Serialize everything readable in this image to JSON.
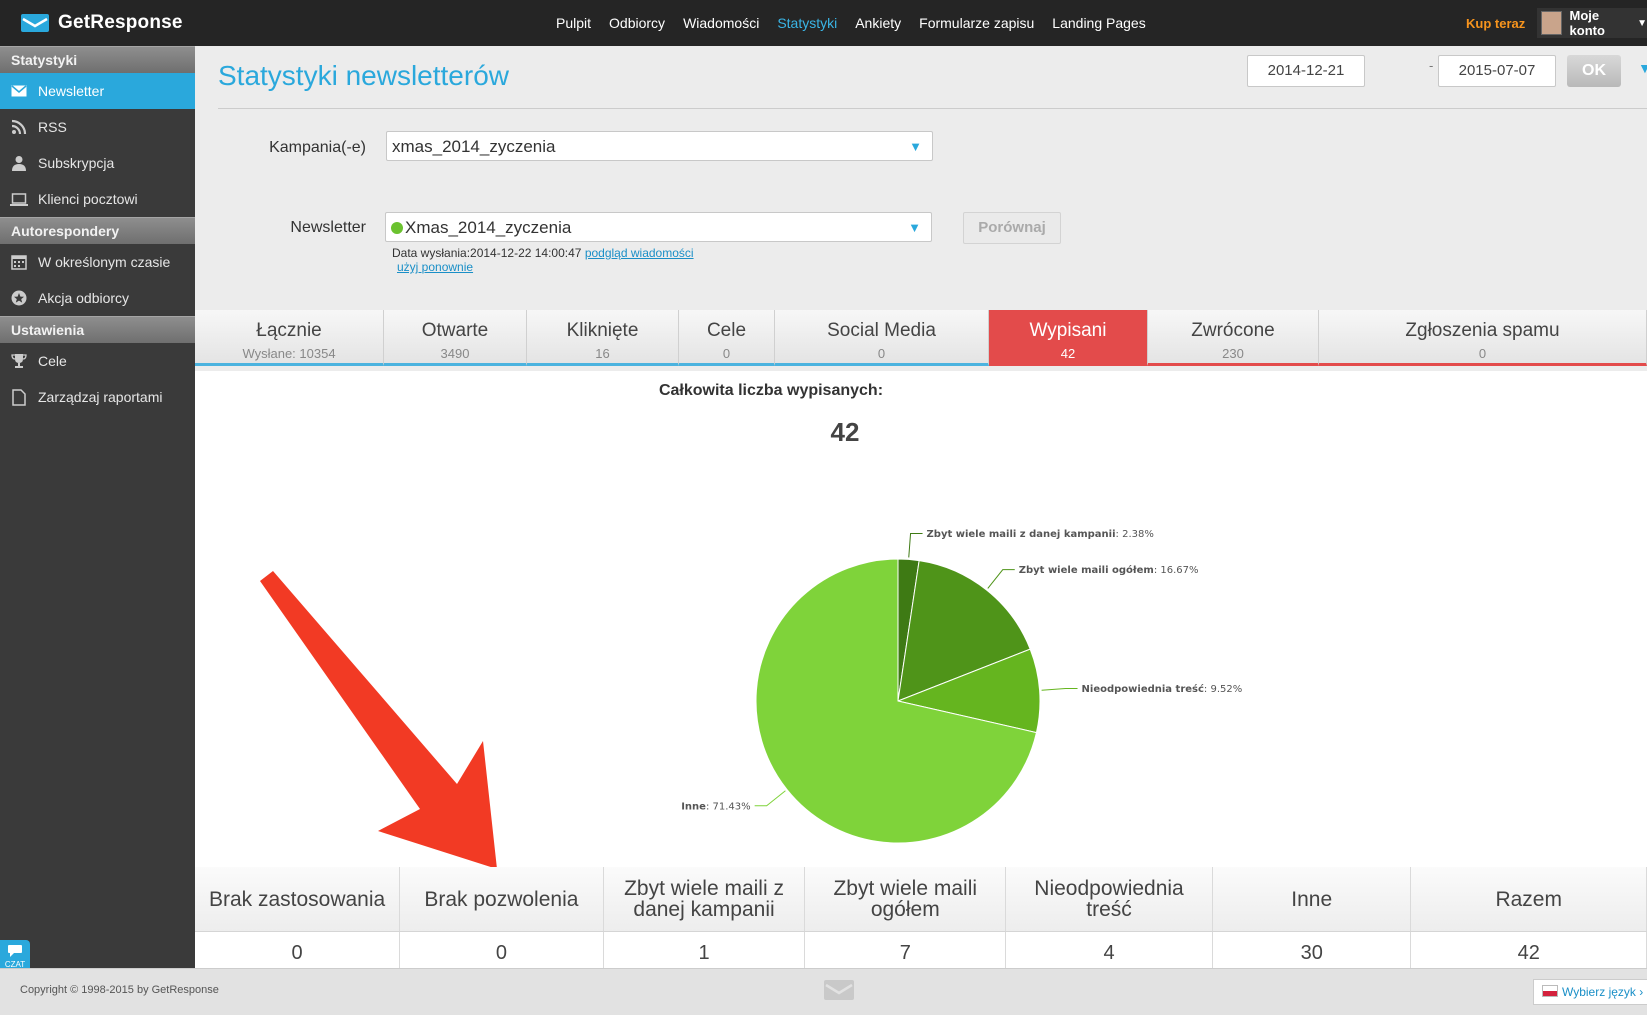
{
  "brand": {
    "name": "GetResponse"
  },
  "topnav": {
    "items": [
      "Pulpit",
      "Odbiorcy",
      "Wiadomości",
      "Statystyki",
      "Ankiety",
      "Formularze zapisu",
      "Landing Pages"
    ],
    "active": "Statystyki",
    "buy_label": "Kup teraz",
    "account_label": "Moje konto"
  },
  "sidebar": {
    "sections": [
      {
        "title": "Statystyki",
        "items": [
          {
            "label": "Newsletter",
            "icon": "envelope-icon",
            "active": true
          },
          {
            "label": "RSS",
            "icon": "rss-icon"
          },
          {
            "label": "Subskrypcja",
            "icon": "user-icon"
          },
          {
            "label": "Klienci pocztowi",
            "icon": "laptop-icon"
          }
        ]
      },
      {
        "title": "Autorespondery",
        "items": [
          {
            "label": "W określonym czasie",
            "icon": "calendar-icon"
          },
          {
            "label": "Akcja odbiorcy",
            "icon": "star-circle-icon"
          }
        ]
      },
      {
        "title": "Ustawienia",
        "items": [
          {
            "label": "Cele",
            "icon": "trophy-icon"
          },
          {
            "label": "Zarządzaj raportami",
            "icon": "document-icon"
          }
        ]
      }
    ],
    "chat_label": "CZAT"
  },
  "page": {
    "title": "Statystyki newsletterów",
    "date_from": "2014-12-21",
    "date_sep": "-",
    "date_to": "2015-07-07",
    "ok_label": "OK"
  },
  "form": {
    "campaign_label": "Kampania(-e)",
    "campaign_value": "xmas_2014_zyczenia",
    "newsletter_label": "Newsletter",
    "newsletter_value": "Xmas_2014_zyczenia",
    "compare_label": "Porównaj",
    "send_date_text": "Data wysłania:2014-12-22 14:00:47",
    "preview_link": "podgląd wiadomości",
    "reuse_link": "użyj ponownie"
  },
  "tabs": [
    {
      "label": "Łącznie",
      "sub": "Wysłane: 10354"
    },
    {
      "label": "Otwarte",
      "sub": "3490"
    },
    {
      "label": "Kliknięte",
      "sub": "16"
    },
    {
      "label": "Cele",
      "sub": "0"
    },
    {
      "label": "Social Media",
      "sub": "0"
    },
    {
      "label": "Wypisani",
      "sub": "42",
      "active": true
    },
    {
      "label": "Zwrócone",
      "sub": "230"
    },
    {
      "label": "Zgłoszenia spamu",
      "sub": "0"
    }
  ],
  "summary": {
    "label": "Całkowita liczba wypisanych:",
    "value": "42"
  },
  "chart_data": {
    "type": "pie",
    "title": "",
    "slices": [
      {
        "name": "Zbyt wiele maili z danej kampanii",
        "value": 2.38,
        "label": "2.38%",
        "color": "#3e7a14"
      },
      {
        "name": "Zbyt wiele maili ogółem",
        "value": 16.67,
        "label": "16.67%",
        "color": "#4f9419"
      },
      {
        "name": "Nieodpowiednia treść",
        "value": 9.52,
        "label": "9.52%",
        "color": "#65b51f"
      },
      {
        "name": "Inne",
        "value": 71.43,
        "label": "71.43%",
        "color": "#7fd33a"
      }
    ]
  },
  "table": {
    "headers": [
      "Brak zastosowania",
      "Brak pozwolenia",
      "Zbyt wiele maili z danej kampanii",
      "Zbyt wiele maili ogółem",
      "Nieodpowiednia treść",
      "Inne",
      "Razem"
    ],
    "values": [
      "0",
      "0",
      "1",
      "7",
      "4",
      "30",
      "42"
    ]
  },
  "annotation": {
    "color": "#f23a24"
  },
  "footer": {
    "copyright": "Copyright © 1998-2015 by GetResponse",
    "language_label": "Wybierz język"
  }
}
